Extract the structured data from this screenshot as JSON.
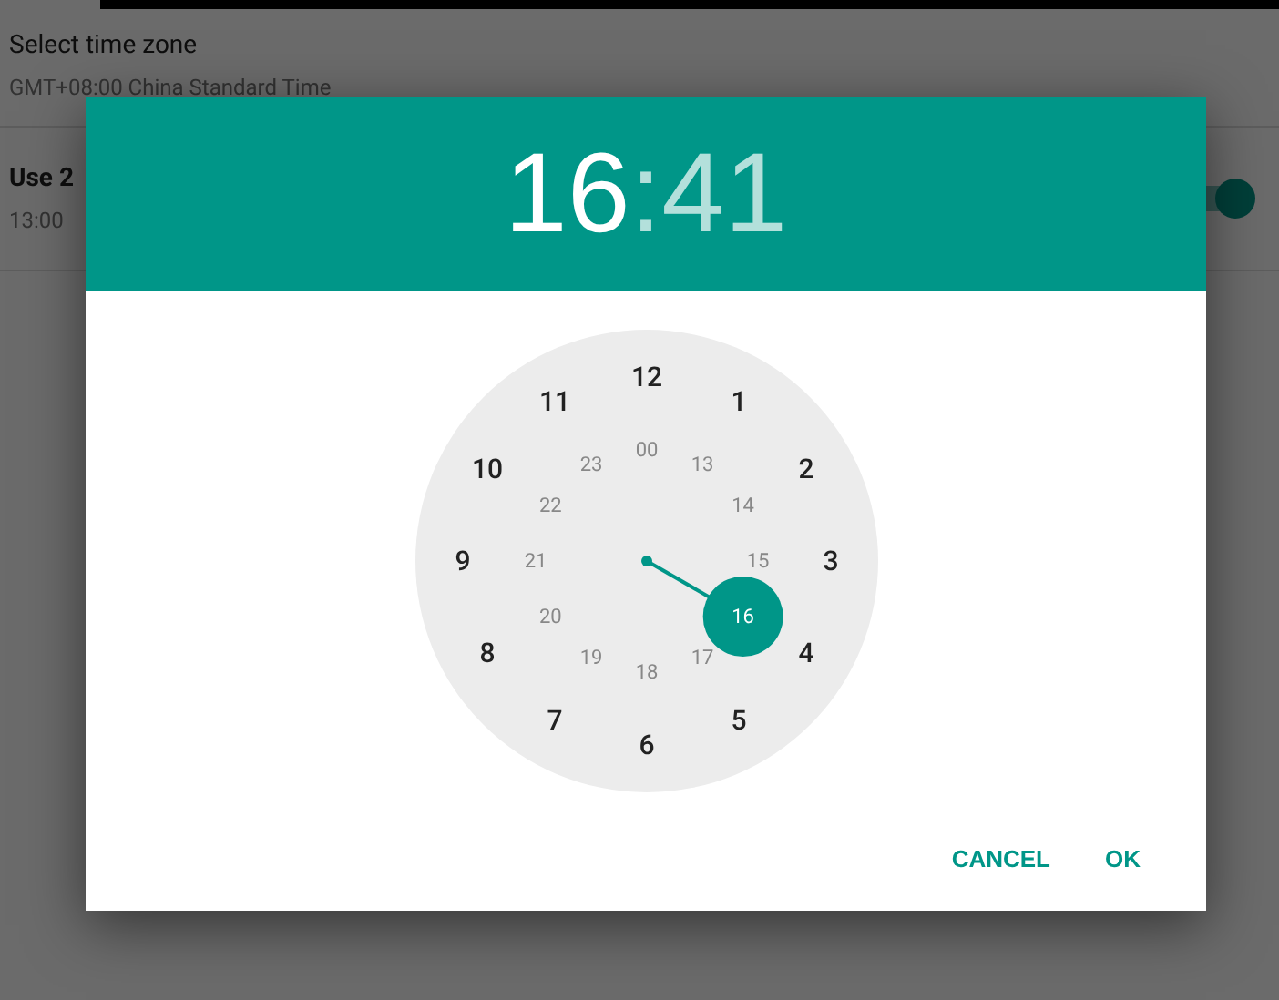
{
  "settings": {
    "time_zone_title": "Select time zone",
    "time_zone_value": "GMT+08:00 China Standard Time",
    "format_label": "Use 2",
    "format_example": "13:00",
    "format_toggle_on": true
  },
  "dialog": {
    "hour": {
      "text": "16",
      "selected": true
    },
    "separator": ":",
    "minute": {
      "text": "41",
      "selected": false
    },
    "outer_ring": [
      {
        "label": "12",
        "selected": false
      },
      {
        "label": "1",
        "selected": false
      },
      {
        "label": "2",
        "selected": false
      },
      {
        "label": "3",
        "selected": false
      },
      {
        "label": "4",
        "selected": false
      },
      {
        "label": "5",
        "selected": false
      },
      {
        "label": "6",
        "selected": false
      },
      {
        "label": "7",
        "selected": false
      },
      {
        "label": "8",
        "selected": false
      },
      {
        "label": "9",
        "selected": false
      },
      {
        "label": "10",
        "selected": false
      },
      {
        "label": "11",
        "selected": false
      }
    ],
    "inner_ring": [
      {
        "label": "00",
        "selected": false
      },
      {
        "label": "13",
        "selected": false
      },
      {
        "label": "14",
        "selected": false
      },
      {
        "label": "15",
        "selected": false
      },
      {
        "label": "16",
        "selected": true
      },
      {
        "label": "17",
        "selected": false
      },
      {
        "label": "18",
        "selected": false
      },
      {
        "label": "19",
        "selected": false
      },
      {
        "label": "20",
        "selected": false
      },
      {
        "label": "21",
        "selected": false
      },
      {
        "label": "22",
        "selected": false
      },
      {
        "label": "23",
        "selected": false
      }
    ],
    "buttons": [
      "CANCEL",
      "OK"
    ]
  }
}
